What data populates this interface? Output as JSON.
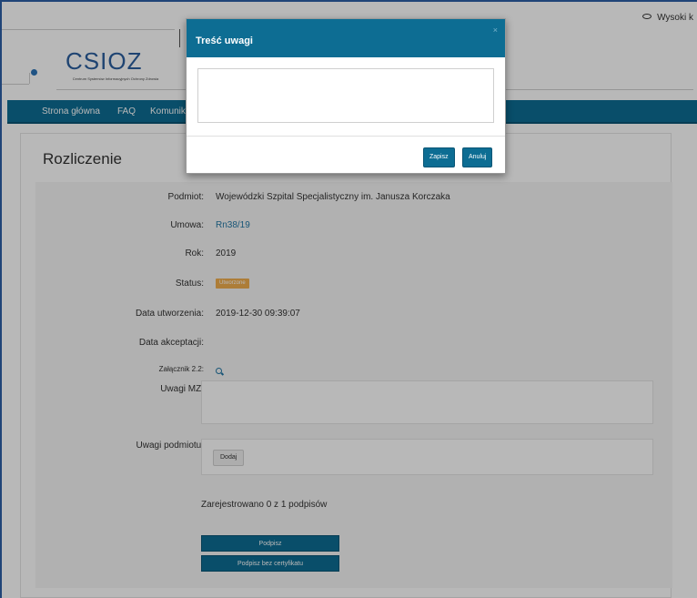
{
  "header": {
    "contrast_label": "Wysoki k",
    "logo_text": "CSIOZ",
    "logo_sub": "Centrum Systemów Informacyjnych Ochrony Zdrowia"
  },
  "nav": {
    "items": [
      "Strona główna",
      "FAQ",
      "Komunika"
    ]
  },
  "page": {
    "title": "Rozliczenie",
    "fields": {
      "podmiot_label": "Podmiot:",
      "podmiot_value": "Wojewódzki Szpital Specjalistyczny im. Janusza Korczaka",
      "umowa_label": "Umowa:",
      "umowa_value": "Rn38/19",
      "rok_label": "Rok:",
      "rok_value": "2019",
      "status_label": "Status:",
      "status_value": "Utworzone",
      "data_utw_label": "Data utworzenia:",
      "data_utw_value": "2019-12-30 09:39:07",
      "data_akc_label": "Data akceptacji:",
      "zal_label": "Załącznik 2.2:",
      "uwagi_mz_label": "Uwagi MZ:",
      "uwagi_podm_label": "Uwagi podmiotu:"
    },
    "dodaj_label": "Dodaj",
    "signatures_text": "Zarejestrowano 0 z 1 podpisów",
    "podpisz_label": "Podpisz",
    "podpisz_bez_label": "Podpisz bez certyfikatu"
  },
  "modal": {
    "title": "Treść uwagi",
    "close_glyph": "×",
    "textarea_value": "",
    "save_label": "Zapisz",
    "cancel_label": "Anuluj"
  },
  "colors": {
    "primary": "#0d6d93",
    "badge": "#f0ad4e",
    "link": "#2378a6"
  }
}
